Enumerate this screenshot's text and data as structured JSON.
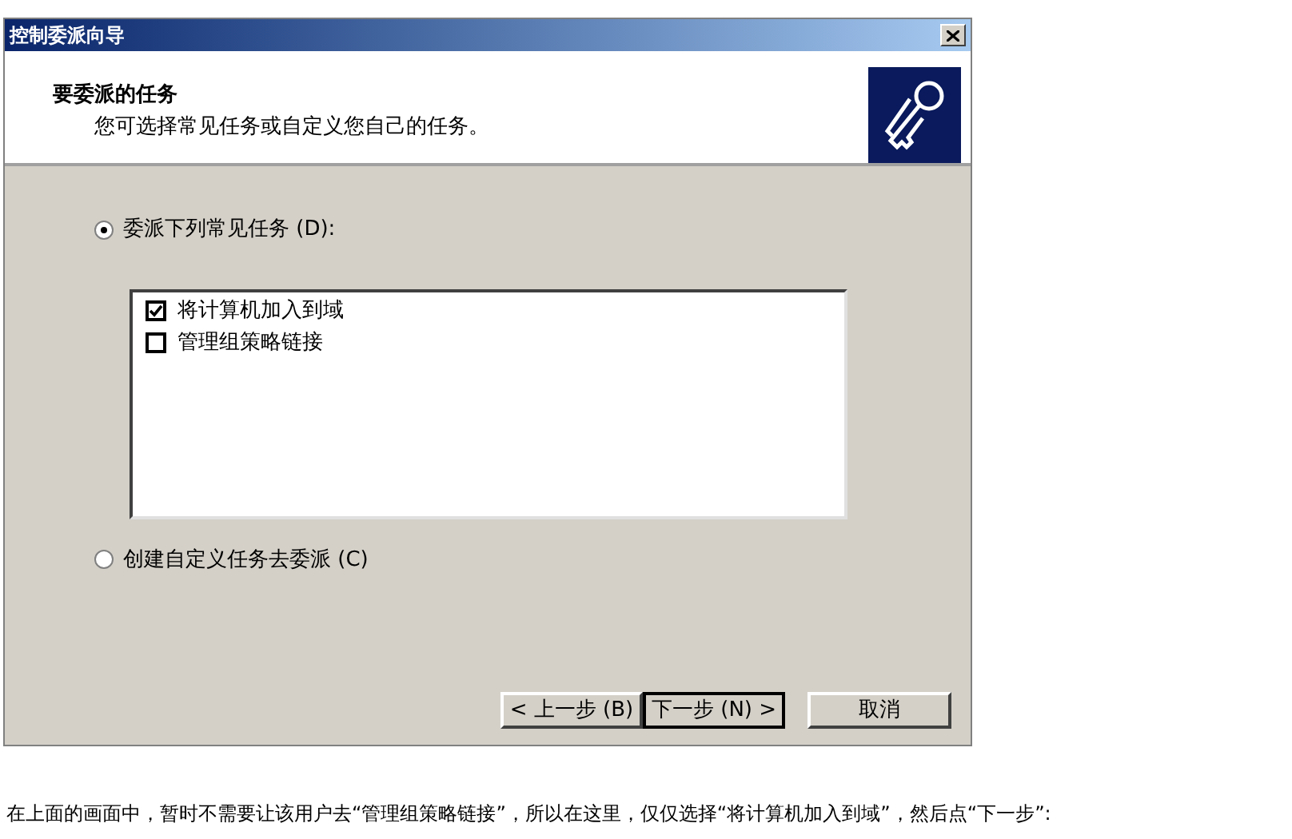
{
  "window": {
    "title": "控制委派向导"
  },
  "header": {
    "title": "要委派的任务",
    "subtitle": "您可选择常见任务或自定义您自己的任务。"
  },
  "options": [
    {
      "label": "委派下列常见任务 (D):",
      "selected": true
    },
    {
      "label": "创建自定义任务去委派 (C)",
      "selected": false
    }
  ],
  "tasks": [
    {
      "label": "将计算机加入到域",
      "checked": true
    },
    {
      "label": "管理组策略链接",
      "checked": false
    }
  ],
  "buttons": [
    {
      "label": "< 上一步 (B)",
      "default": false
    },
    {
      "label": "下一步 (N) >",
      "default": true
    },
    {
      "label": "取消",
      "default": false
    }
  ],
  "caption": "在上面的画面中，暂时不需要让该用户去“管理组策略链接”，所以在这里，仅仅选择“将计算机加入到域”，然后点“下一步”:"
}
